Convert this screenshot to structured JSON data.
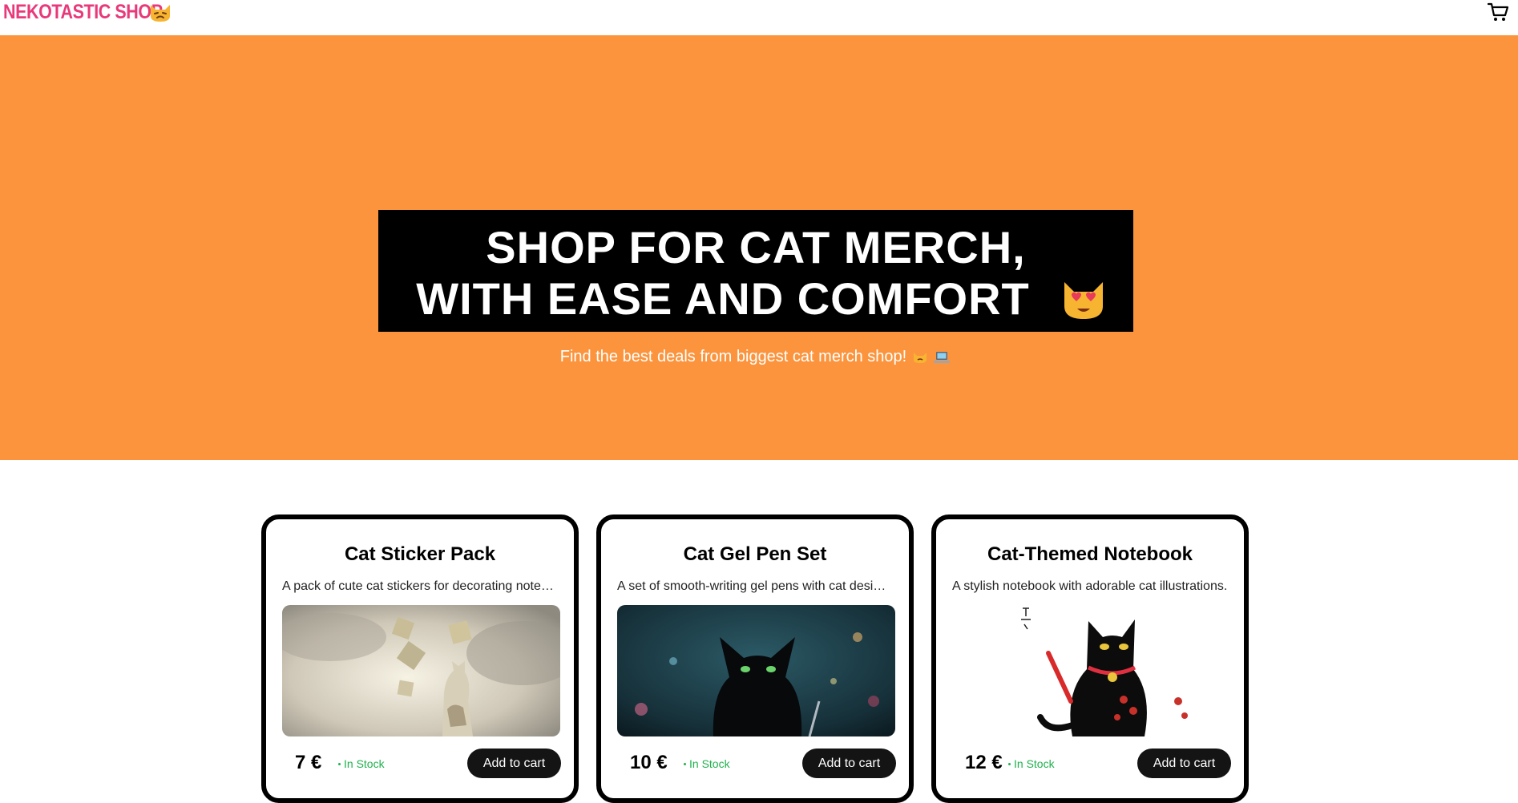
{
  "header": {
    "brand": "NEKOTASTIC SHOP",
    "brand_icon": "cat-face-emoji",
    "cart_icon": "shopping-cart-icon"
  },
  "hero": {
    "title_line1": "SHOP FOR CAT MERCH,",
    "title_line2": "WITH EASE AND COMFORT",
    "title_icon": "heart-eyes-cat-emoji",
    "subtitle": "Find the best deals from biggest cat merch shop!",
    "subtitle_icons": [
      "cat-emoji",
      "laptop-emoji"
    ]
  },
  "products": [
    {
      "title": "Cat Sticker Pack",
      "description": "A pack of cute cat stickers for decorating notebooks and laptops.",
      "image": "watercolor-cat-puzzle-image",
      "price": "7 €",
      "stock": "In Stock",
      "button": "Add to cart"
    },
    {
      "title": "Cat Gel Pen Set",
      "description": "A set of smooth-writing gel pens with cat designs.",
      "image": "black-cat-with-pen-image",
      "price": "10 €",
      "stock": "In Stock",
      "button": "Add to cart"
    },
    {
      "title": "Cat-Themed Notebook",
      "description": "A stylish notebook with adorable cat illustrations.",
      "image": "black-cat-ink-illustration-image",
      "price": "12 €",
      "stock": "In Stock",
      "button": "Add to cart"
    }
  ],
  "colors": {
    "brand": "#e8397a",
    "hero_bg": "#fb943d",
    "stock": "#1fb24d",
    "button": "#141414"
  }
}
